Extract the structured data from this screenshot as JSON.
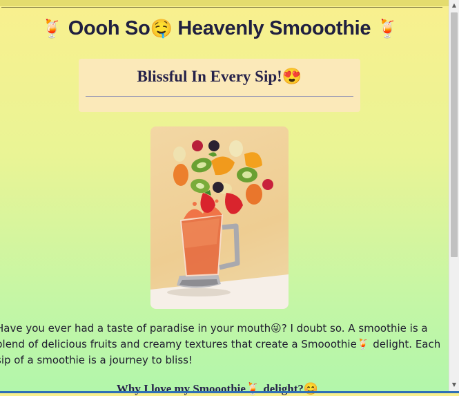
{
  "header": {
    "title_left_emoji": "🍹",
    "title_part1": "Oooh So",
    "title_mid_emoji": "🤤",
    "title_part2": "Heavenly Smooothie",
    "title_right_emoji": "🍹"
  },
  "tagline": {
    "text": "Blissful In Every Sip!",
    "emoji": "😍"
  },
  "hero_image": {
    "alt": "smoothie blender with flying fruits"
  },
  "intro": {
    "part1": "Have you ever had a taste of paradise in your mouth",
    "emoji1": "😜",
    "part2": "? I doubt so. A smoothie is a blend of delicious fruits and creamy textures that create a Smooothie",
    "emoji2": "🍹",
    "part3": " delight. Each sip of a smoothie is a journey to bliss!"
  },
  "section": {
    "heading_part1": "Why I love my Smooothie",
    "heading_emoji1": "🍹",
    "heading_part2": " delight?",
    "heading_emoji2": "😊"
  },
  "colors": {
    "gradient_top": "#f9f08e",
    "gradient_bottom": "#b2f6ab",
    "tagline_box": "#fbe9b9",
    "heading_text": "#202040"
  }
}
